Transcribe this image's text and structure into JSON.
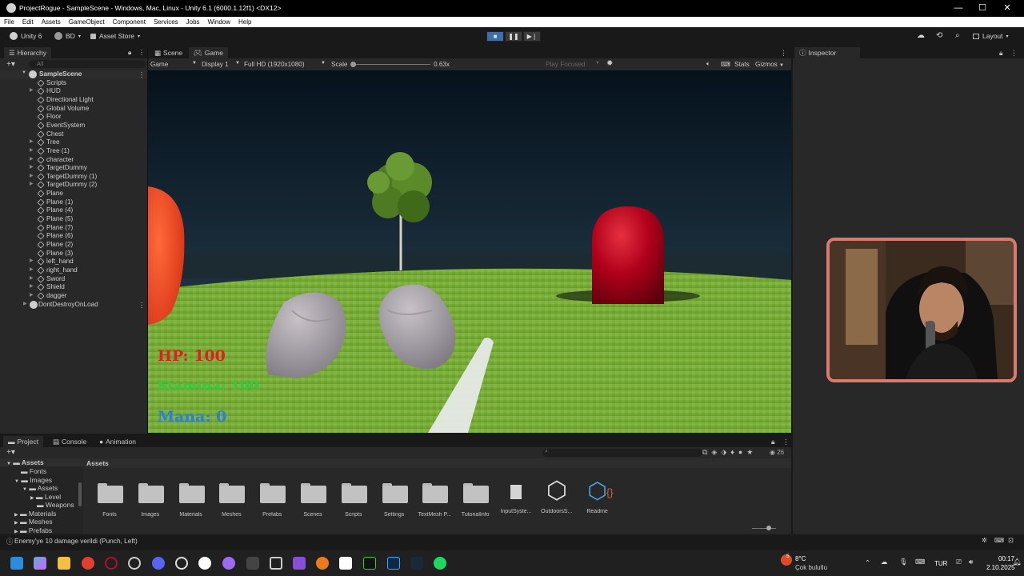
{
  "window": {
    "title": "ProjectRogue - SampleScene - Windows, Mac, Linux - Unity 6.1 (6000.1.12f1) <DX12>",
    "controls": [
      "—",
      "☐",
      "✕"
    ]
  },
  "menu": [
    "File",
    "Edit",
    "Assets",
    "GameObject",
    "Component",
    "Services",
    "Jobs",
    "Window",
    "Help"
  ],
  "toolbar": {
    "unity": "Unity 6",
    "account": "BD",
    "asset_store": "Asset Store",
    "layout": "Layout"
  },
  "hierarchy": {
    "tab": "Hierarchy",
    "search_placeholder": "All",
    "scene": "SampleScene",
    "items": [
      "Scripts",
      "HUD",
      "Directional Light",
      "Global Volume",
      "Floor",
      "EventSystem",
      "Chest",
      "Tree",
      "Tree (1)",
      "character",
      "TargetDummy",
      "TargetDummy (1)",
      "TargetDummy (2)",
      "Plane",
      "Plane (1)",
      "Plane (4)",
      "Plane (5)",
      "Plane (7)",
      "Plane (6)",
      "Plane (2)",
      "Plane (3)",
      "left_hand",
      "right_hand",
      "Sword",
      "Shield",
      "dagger"
    ],
    "dont_destroy": "DontDestroyOnLoad"
  },
  "view_tabs": {
    "scene": "Scene",
    "game": "Game"
  },
  "gamebar": {
    "mode": "Game",
    "display": "Display 1",
    "resolution": "Full HD (1920x1080)",
    "scale_label": "Scale",
    "scale_value": "0.63x",
    "play_focused": "Play Focused",
    "stats": "Stats",
    "gizmos": "Gizmos"
  },
  "hud": {
    "hp": "HP: 100",
    "stamina": "Stamina: 100",
    "mana": "Mana: 0"
  },
  "inspector": {
    "tab": "Inspector"
  },
  "bottom_tabs": {
    "project": "Project",
    "console": "Console",
    "animation": "Animation"
  },
  "project": {
    "tree_root": "Assets",
    "tree": [
      "Fonts",
      "Images",
      "Assets",
      "Level",
      "Weapons",
      "Materials",
      "Meshes",
      "Prefabs"
    ],
    "breadcrumb": "Assets",
    "count": "26",
    "assets": [
      "Fonts",
      "Images",
      "Materials",
      "Meshes",
      "Prefabs",
      "Scenes",
      "Scripts",
      "Settings",
      "TextMesh P...",
      "TutorialInfo",
      "InputSyste...",
      "OutdoorsS...",
      "Readme"
    ]
  },
  "status": {
    "message": "Enemy'ye 10 damage verildi (Punch, Left)"
  },
  "taskbar": {
    "weather_temp": "8°C",
    "weather_desc": "Çok bulutlu",
    "lang": "TUR",
    "time": "00:17",
    "date": "2.10.2025",
    "notif": "5"
  },
  "colors": {
    "hp": "#e02020",
    "stamina": "#2ecc40",
    "mana": "#2a7fd6",
    "dummy": "#b00010"
  }
}
